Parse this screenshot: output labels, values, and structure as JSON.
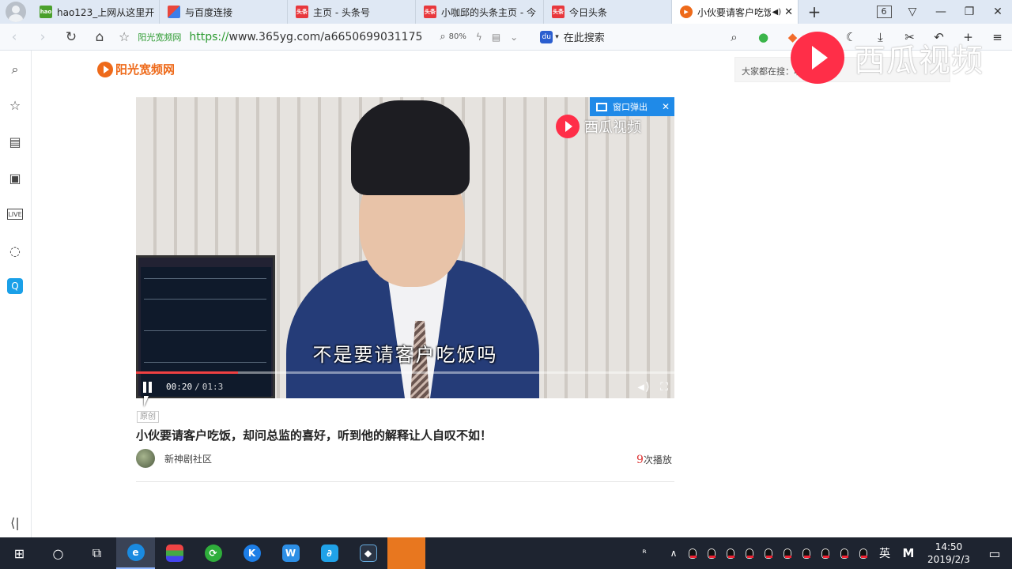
{
  "browser": {
    "tabs": [
      {
        "label": "hao123_上网从这里开",
        "icon_color": "#4aa02c",
        "icon_text": "hao"
      },
      {
        "label": "与百度连接",
        "icon_color": "#e8463c",
        "icon_text": ""
      },
      {
        "label": "主页 - 头条号",
        "icon_color": "#e8383d",
        "icon_text": "头条"
      },
      {
        "label": "小咖邱的头条主页 - 今",
        "icon_color": "#e8383d",
        "icon_text": "头条"
      },
      {
        "label": "今日头条",
        "icon_color": "#e8383d",
        "icon_text": "头条"
      }
    ],
    "active_tab": {
      "label": "小伙要请客户吃饭",
      "icon_color": "#ee6a1a"
    },
    "tab_count": "6",
    "site_name": "阳光宽频网",
    "url_protocol": "https://",
    "url_rest": "www.365yg.com/a6650699031175",
    "zoom": "80%",
    "search_placeholder": "在此搜索"
  },
  "page": {
    "logo_text": "阳光宽频网",
    "hot_search": "大家都在搜：收  的红",
    "watermark": "西瓜视频"
  },
  "video": {
    "popout_label": "窗口弹出",
    "watermark": "西瓜视频",
    "subtitle": "不是要请客户吃饭吗",
    "current_time": "00:20",
    "duration": "01:3",
    "progress": 0.19,
    "badge": "原创",
    "title": "小伙要请客户吃饭，却问总监的喜好，听到他的解释让人自叹不如！",
    "author": "新神剧社区",
    "play_count": "9",
    "play_suffix": "次播放"
  },
  "taskbar": {
    "ime": "英",
    "time": "14:50",
    "date": "2019/2/3"
  },
  "colors": {
    "accent": "#ee6a1a",
    "progress": "#f04142",
    "popout": "#1f8ae8",
    "taskbar": "#1e2430"
  }
}
